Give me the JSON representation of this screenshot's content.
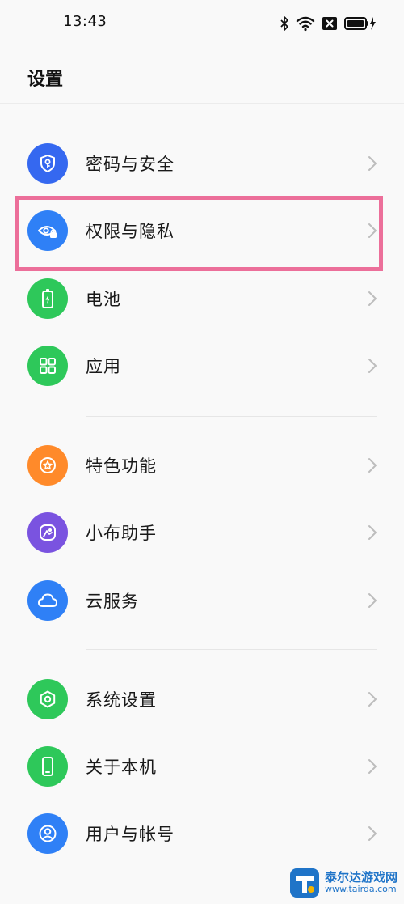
{
  "status_bar": {
    "time": "13:43",
    "icons": [
      "bluetooth-icon",
      "wifi-icon",
      "sim-off-icon",
      "battery-charging-icon"
    ]
  },
  "page": {
    "title": "设置"
  },
  "colors": {
    "blue": "#2f80f6",
    "indigo": "#3568f0",
    "green": "#2ec85a",
    "orange": "#ff8a2a",
    "purple": "#7a53e0",
    "highlight": "#ec6f9a"
  },
  "sections": [
    {
      "items": [
        {
          "label": "密码与安全",
          "icon": "shield-key-icon"
        },
        {
          "label": "权限与隐私",
          "icon": "eye-lock-icon",
          "highlighted": true
        },
        {
          "label": "电池",
          "icon": "battery-icon"
        },
        {
          "label": "应用",
          "icon": "apps-grid-icon"
        }
      ]
    },
    {
      "items": [
        {
          "label": "特色功能",
          "icon": "star-badge-icon"
        },
        {
          "label": "小布助手",
          "icon": "assistant-icon"
        },
        {
          "label": "云服务",
          "icon": "cloud-icon"
        }
      ]
    },
    {
      "items": [
        {
          "label": "系统设置",
          "icon": "hexagon-gear-icon"
        },
        {
          "label": "关于本机",
          "icon": "phone-icon"
        },
        {
          "label": "用户与帐号",
          "icon": "user-icon"
        }
      ]
    }
  ],
  "watermark": {
    "name": "泰尔达游戏网",
    "url": "www.tairda.com"
  }
}
